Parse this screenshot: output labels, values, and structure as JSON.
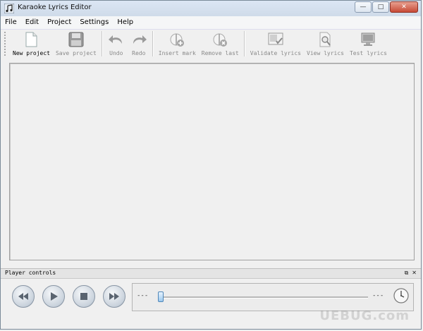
{
  "window": {
    "title": "Karaoke Lyrics Editor",
    "controls": {
      "minimize": "—",
      "maximize": "□",
      "close": "✕"
    }
  },
  "menu": [
    "File",
    "Edit",
    "Project",
    "Settings",
    "Help"
  ],
  "toolbar": {
    "new_project": "New project",
    "save_project": "Save project",
    "undo": "Undo",
    "redo": "Redo",
    "insert_mark": "Insert mark",
    "remove_last": "Remove last",
    "validate_lyrics": "Validate lyrics",
    "view_lyrics": "View lyrics",
    "test_lyrics": "Test lyrics"
  },
  "player": {
    "title": "Player controls",
    "dock_buttons": {
      "float": "⧉",
      "close": "✕"
    },
    "time_left": "---",
    "time_right": "---",
    "position": 0.0
  },
  "watermark": "UEBUG.com",
  "colors": {
    "accent": "#4f86b8",
    "disabled_text": "#888888"
  }
}
